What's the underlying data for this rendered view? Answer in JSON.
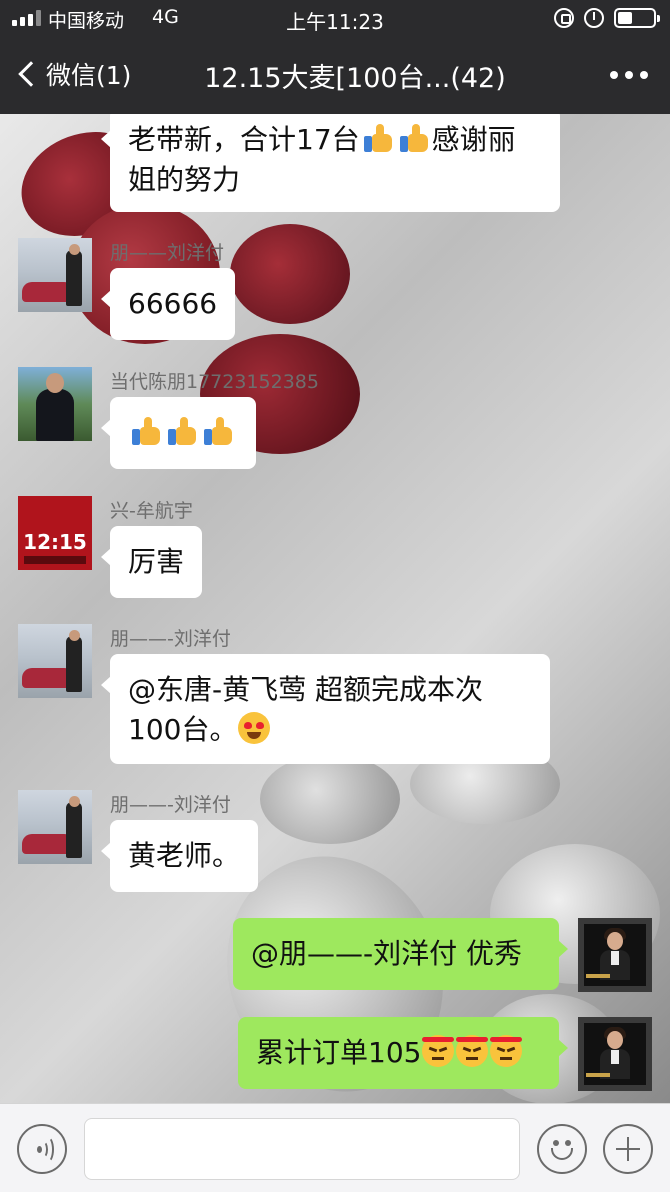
{
  "status_bar": {
    "carrier": "中国移动",
    "network": "4G",
    "time": "上午11:23"
  },
  "nav": {
    "back_label": "微信(1)",
    "title": "12.15大麦[100台...(42)"
  },
  "messages": [
    {
      "from": "other",
      "sender": "",
      "lines": [
        "老带新，合计17台",
        "姐的努力"
      ],
      "line1_suffix": "感谢丽"
    },
    {
      "from": "other",
      "sender": "朋——刘洋付",
      "text": "66666"
    },
    {
      "from": "other",
      "sender": "当代陈朋17723152385",
      "text": ""
    },
    {
      "from": "other",
      "sender": "兴-牟航宇",
      "text": "厉害"
    },
    {
      "from": "other",
      "sender": "朋——-刘洋付",
      "lines": [
        "@东唐-黄飞莺   超额完成本次",
        "100台。"
      ]
    },
    {
      "from": "other",
      "sender": "朋——-刘洋付",
      "text": "黄老师。"
    },
    {
      "from": "self",
      "text": "@朋——-刘洋付 优秀"
    },
    {
      "from": "self",
      "text": "累计订单105"
    }
  ],
  "avatars": {
    "poster_top": "",
    "poster_date": "12:15"
  },
  "icons": {
    "back": "chevron-left-icon",
    "more": "more-dots-icon",
    "voice": "voice-icon",
    "emoji": "emoji-icon",
    "plus": "plus-icon"
  },
  "colors": {
    "nav_bg": "#2b2b2d",
    "self_bubble": "#9ee85e",
    "other_bubble": "#ffffff",
    "input_bar": "#f4f4f6"
  }
}
